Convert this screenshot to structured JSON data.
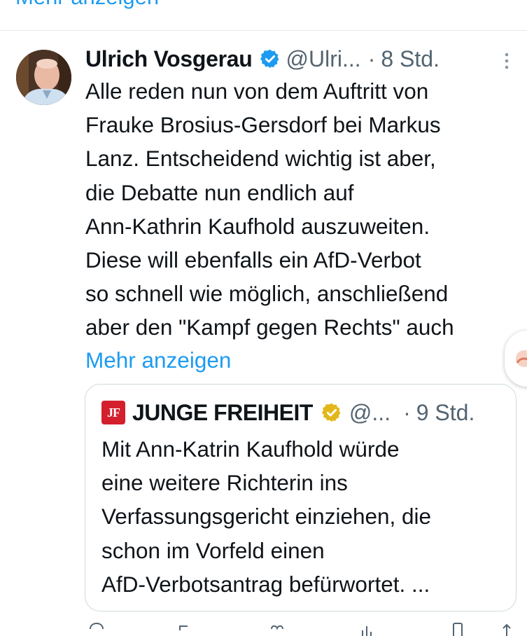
{
  "previous_tweet": {
    "show_more": "Mehr anzeigen"
  },
  "tweet": {
    "author_name": "Ulrich Vosgerau",
    "handle": "@Ulri...",
    "separator": "·",
    "time": "8 Std.",
    "text_lines": [
      "Alle reden nun von dem Auftritt von",
      "Frauke Brosius-Gersdorf bei Markus",
      "Lanz. Entscheidend wichtig ist aber,",
      "die Debatte nun endlich auf",
      "Ann-Kathrin Kaufhold auszuweiten.",
      "Diese will ebenfalls ein AfD-Verbot",
      "so schnell wie möglich, anschließend",
      "aber den \"Kampf gegen Rechts\" auch"
    ],
    "show_more": "Mehr anzeigen"
  },
  "quote": {
    "logo_text": "JF",
    "author_name": "JUNGE FREIHEIT",
    "handle": "@...",
    "separator": "·",
    "time": "9 Std.",
    "text_lines": [
      "Mit Ann-Katrin Kaufhold würde",
      "eine weitere Richterin ins",
      "Verfassungsgericht einziehen, die",
      "schon im Vorfeld einen",
      "AfD-Verbotsantrag befürwortet. ..."
    ]
  },
  "colors": {
    "link_blue": "#1d9bf0",
    "verified_blue": "#1d9bf0",
    "verified_gold": "#e2b719",
    "logo_red": "#d41f2d",
    "secondary_text": "#536471",
    "border": "#cfd9de"
  },
  "icons": [
    "verified-badge-icon",
    "more-options-icon",
    "gold-verified-badge-icon",
    "reply-icon",
    "retweet-icon",
    "like-icon",
    "views-icon",
    "bookmark-icon",
    "share-icon"
  ]
}
